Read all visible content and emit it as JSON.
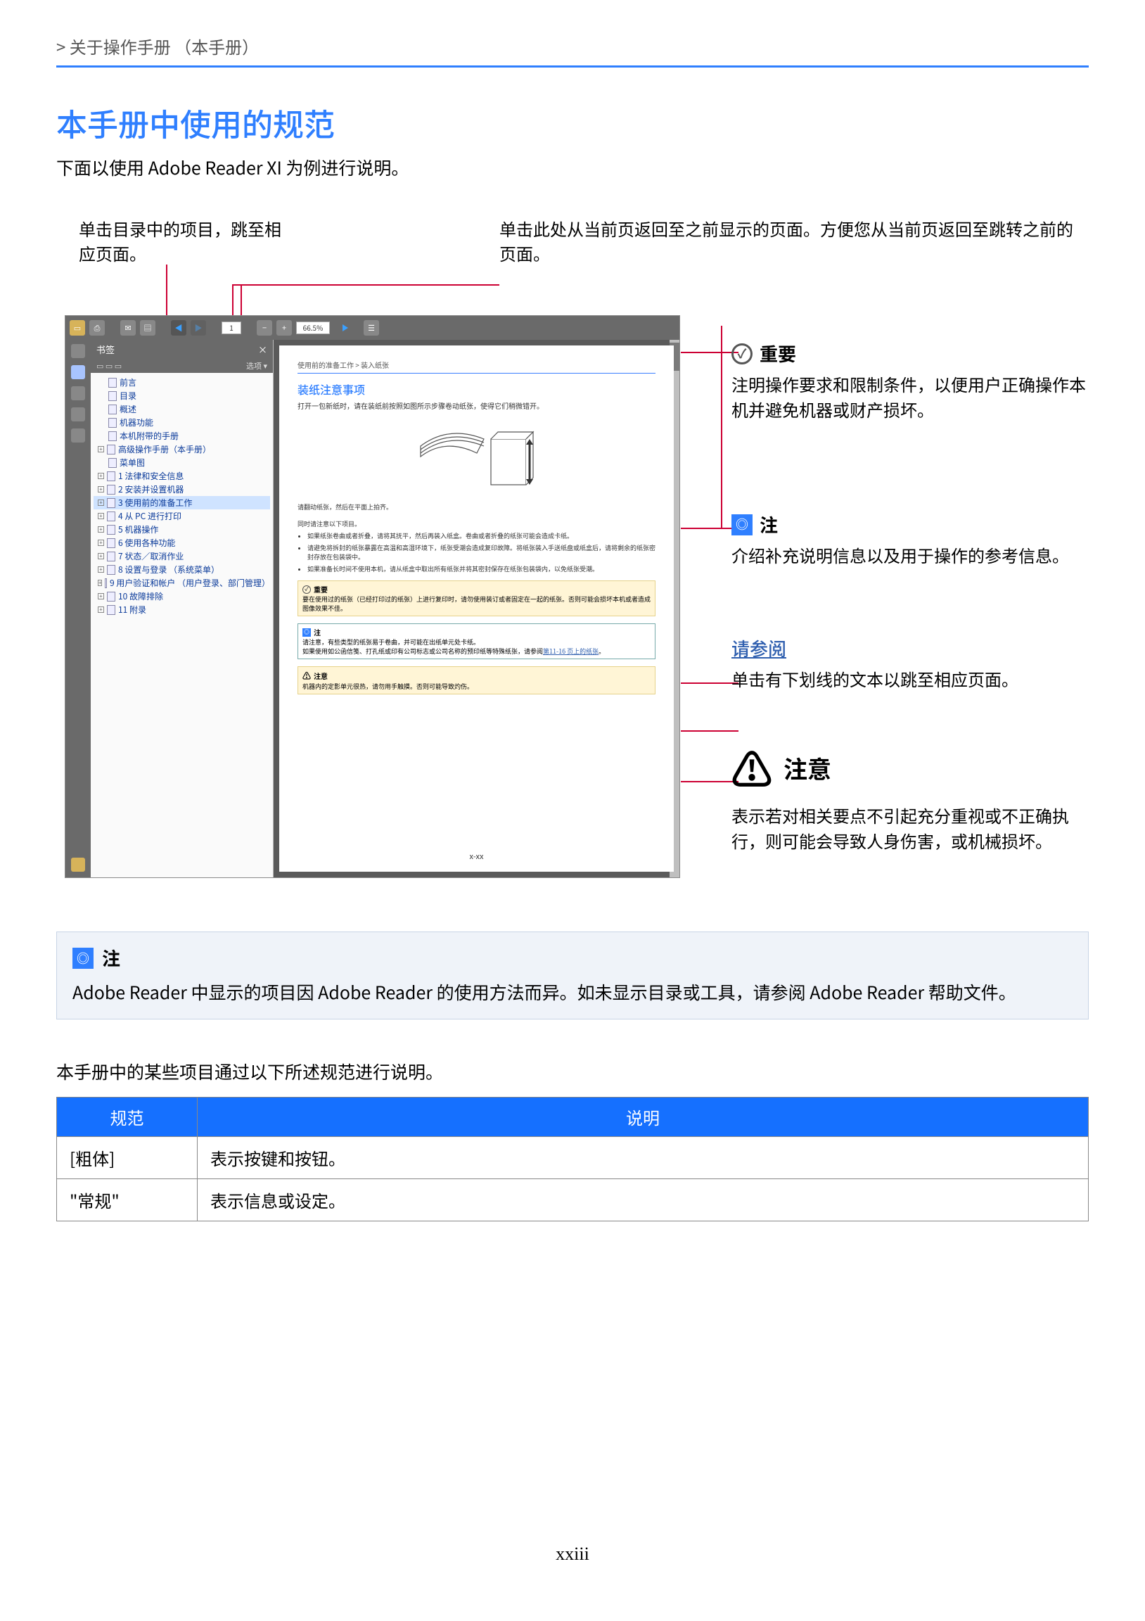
{
  "header": {
    "breadcrumb": "> 关于操作手册 （本手册）"
  },
  "title": "本手册中使用的规范",
  "intro": "下面以使用 Adobe Reader XI 为例进行说明。",
  "callouts": {
    "toc_click": "单击目录中的项目，跳至相应页面。",
    "back_click": "单击此处从当前页返回至之前显示的页面。方便您从当前页返回至跳转之前的页面。"
  },
  "toolbar": {
    "page": "1",
    "zoom": "66.5%"
  },
  "bookmarks": {
    "title": "书签",
    "options": "选项",
    "close": "×",
    "items": [
      {
        "label": "前言",
        "exp": null
      },
      {
        "label": "目录",
        "exp": null
      },
      {
        "label": "概述",
        "exp": null
      },
      {
        "label": "机器功能",
        "exp": null
      },
      {
        "label": "本机附带的手册",
        "exp": null
      },
      {
        "label": "高级操作手册（本手册）",
        "exp": "+"
      },
      {
        "label": "菜单图",
        "exp": null
      },
      {
        "label": "1 法律和安全信息",
        "exp": "+"
      },
      {
        "label": "2 安装并设置机器",
        "exp": "+"
      },
      {
        "label": "3 使用前的准备工作",
        "exp": "+",
        "sel": true
      },
      {
        "label": "4 从 PC 进行打印",
        "exp": "+"
      },
      {
        "label": "5 机器操作",
        "exp": "+"
      },
      {
        "label": "6 使用各种功能",
        "exp": "+"
      },
      {
        "label": "7 状态／取消作业",
        "exp": "+"
      },
      {
        "label": "8 设置与登录 （系统菜单）",
        "exp": "+"
      },
      {
        "label": "9 用户验证和帐户 （用户登录、部门管理）",
        "exp": "+"
      },
      {
        "label": "10 故障排除",
        "exp": "+"
      },
      {
        "label": "11 附录",
        "exp": "+"
      }
    ]
  },
  "docpage": {
    "crumbs": "使用前的准备工作 > 装入纸张",
    "heading": "装纸注意事项",
    "sub": "打开一包新纸时，请在装纸前按照如图所示步骤卷动纸张，使得它们稍微错开。",
    "p1": "请翻动纸张，然后在平面上拍齐。",
    "p2": "同时请注意以下项目。",
    "bullets": [
      "如果纸张卷曲或者折叠，请将其抚平，然后再装入纸盒。卷曲或者折叠的纸张可能会造成卡纸。",
      "请避免将拆封的纸张暴露在高温和高湿环境下，纸张受潮会造成复印故障。将纸张装入手送纸盘或纸盒后，请将剩余的纸张密封存放在包装袋中。",
      "如果准备长时间不使用本机，请从纸盒中取出所有纸张并将其密封保存在纸张包装袋内，以免纸张受潮。"
    ],
    "important": {
      "head": "重要",
      "body": "要在使用过的纸张（已经打印过的纸张）上进行复印时，请勿使用装订或者固定在一起的纸张。否则可能会损坏本机或者造成图像效果不佳。"
    },
    "note": {
      "head": "注",
      "body1": "请注意，有些类型的纸张易于卷曲，并可能在出纸单元处卡纸。",
      "body2": "如果使用如公函信笺、打孔纸或印有公司标志或公司名称的预印纸等特殊纸张，请参阅",
      "link": "第11-16 页上的纸张",
      "tail": "。"
    },
    "warn": {
      "head": "注意",
      "body": "机器内的定影单元很热，请勿用手触摸。否则可能导致灼伤。"
    },
    "footer": "x-xx"
  },
  "legend": {
    "important": {
      "title": "重要",
      "desc": "注明操作要求和限制条件，以便用户正确操作本机并避免机器或财产损坏。"
    },
    "note": {
      "title": "注",
      "desc": "介绍补充说明信息以及用于操作的参考信息。"
    },
    "see": {
      "title": "请参阅",
      "desc": "单击有下划线的文本以跳至相应页面。"
    },
    "warn": {
      "title": "注意",
      "desc": "表示若对相关要点不引起充分重视或不正确执行，则可能会导致人身伤害，或机械损坏。"
    }
  },
  "bignote": {
    "title": "注",
    "desc": "Adobe Reader 中显示的项目因 Adobe Reader 的使用方法而异。如未显示目录或工具，请参阅 Adobe Reader 帮助文件。"
  },
  "table": {
    "intro": "本手册中的某些项目通过以下所述规范进行说明。",
    "head": {
      "c1": "规范",
      "c2": "说明"
    },
    "rows": [
      {
        "k": "[粗体]",
        "v": "表示按键和按钮。"
      },
      {
        "k": "\"常规\"",
        "v": "表示信息或设定。"
      }
    ]
  },
  "pagenum": "xxiii"
}
